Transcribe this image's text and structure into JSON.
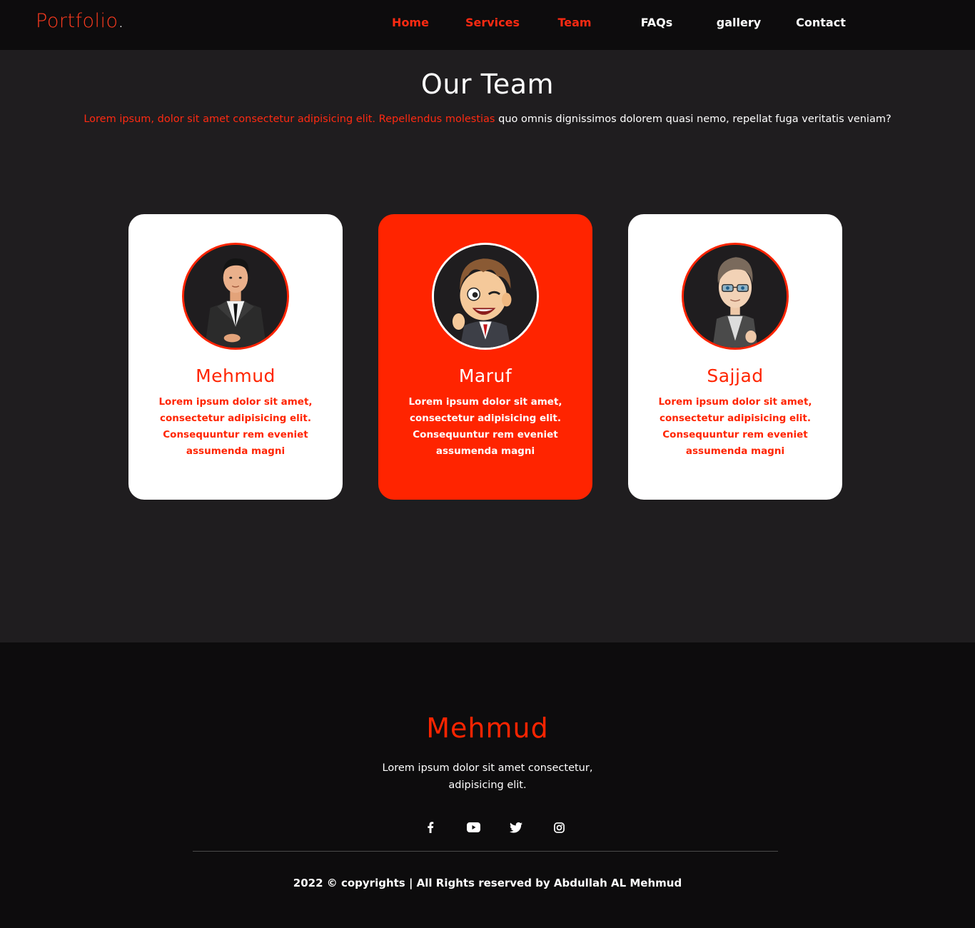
{
  "navbar": {
    "logo_text": "Portfolio",
    "logo_dot": ".",
    "links": [
      {
        "label": "Home"
      },
      {
        "label": "Services"
      },
      {
        "label": "Team"
      },
      {
        "label": "FAQs"
      },
      {
        "label": "gallery"
      },
      {
        "label": "Contact"
      }
    ]
  },
  "team": {
    "title": "Our Team",
    "subtitle_red": "Lorem ipsum, dolor sit amet consectetur adipisicing elit. Repellendus molestias",
    "subtitle_white": " quo omnis dignissimos dolorem quasi nemo, repellat fuga veritatis veniam?",
    "members": [
      {
        "name": "Mehmud",
        "description": "Lorem ipsum dolor sit amet, consectetur adipisicing elit. Consequuntur rem eveniet assumenda magni",
        "avatar": "businessman-avatar"
      },
      {
        "name": "Maruf",
        "description": "Lorem ipsum dolor sit amet, consectetur adipisicing elit. Consequuntur rem eveniet assumenda magni",
        "avatar": "cartoon-winking-avatar"
      },
      {
        "name": "Sajjad",
        "description": "Lorem ipsum dolor sit amet, consectetur adipisicing elit. Consequuntur rem eveniet assumenda magni",
        "avatar": "cartoon-glasses-avatar"
      }
    ]
  },
  "footer": {
    "name": "Mehmud",
    "description": "Lorem ipsum dolor sit amet consectetur, adipisicing elit.",
    "social_icons": [
      "facebook-icon",
      "youtube-icon",
      "twitter-icon",
      "instagram-icon"
    ],
    "copyright": "2022 © copyrights | All Rights reserved by Abdullah AL Mehmud"
  },
  "colors": {
    "accent": "#ff2400",
    "background": "#1f1d1f",
    "navbar_bg": "#0d0c0d",
    "card_bg": "#ffffff"
  }
}
